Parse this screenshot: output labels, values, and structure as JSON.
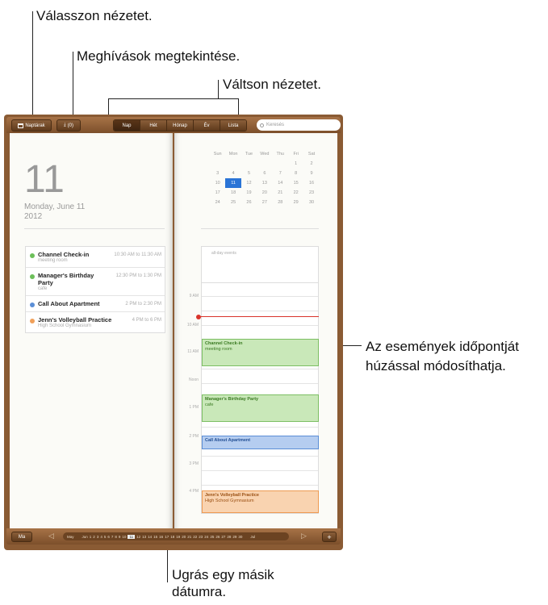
{
  "callouts": {
    "select_view": "Válasszon nézetet.",
    "view_invitations": "Meghívások megtekintése.",
    "switch_view": "Váltson nézetet.",
    "drag_events_1": "Az események időpontját",
    "drag_events_2": "húzással módosíthatja.",
    "jump_date_1": "Ugrás egy másik",
    "jump_date_2": "dátumra."
  },
  "toolbar": {
    "calendars_label": "Naptárak",
    "invitations_label": "(0)",
    "tabs": [
      "Nap",
      "Hét",
      "Hónap",
      "Év",
      "Lista"
    ],
    "active_tab": "Nap",
    "search_placeholder": "Keresés"
  },
  "left_page": {
    "day_number": "11",
    "date_line": "Monday, June 11",
    "year": "2012",
    "events": [
      {
        "title": "Channel Check-in",
        "location": "meeting room",
        "time": "10:30 AM to 11:30 AM",
        "color": "#6cbf5a"
      },
      {
        "title": "Manager's Birthday Party",
        "location": "cafe",
        "time": "12:30 PM to 1:30 PM",
        "color": "#6cbf5a"
      },
      {
        "title": "Call About Apartment",
        "location": "",
        "time": "2 PM to 2:30 PM",
        "color": "#5b8ed6"
      },
      {
        "title": "Jenn's Volleyball Practice",
        "location": "High School Gymnasium",
        "time": "4 PM to 6 PM",
        "color": "#f0a05a"
      }
    ]
  },
  "mini_calendar": {
    "weekdays": [
      "Sun",
      "Mon",
      "Tue",
      "Wed",
      "Thu",
      "Fri",
      "Sat"
    ],
    "weeks": [
      [
        "",
        "",
        "",
        "",
        "",
        "1",
        "2"
      ],
      [
        "3",
        "4",
        "5",
        "6",
        "7",
        "8",
        "9"
      ],
      [
        "10",
        "11",
        "12",
        "13",
        "14",
        "15",
        "16"
      ],
      [
        "17",
        "18",
        "19",
        "20",
        "21",
        "22",
        "23"
      ],
      [
        "24",
        "25",
        "26",
        "27",
        "28",
        "29",
        "30"
      ]
    ],
    "today": "11"
  },
  "day_view": {
    "all_day_label": "all-day events",
    "hour_labels": [
      "9 AM",
      "10 AM",
      "11 AM",
      "Noon",
      "1 PM",
      "2 PM",
      "3 PM",
      "4 PM"
    ],
    "blocks": [
      {
        "title": "Channel Check-in",
        "subtitle": "meeting room",
        "bg": "#c9e8b9",
        "border": "#7cbf63",
        "fg": "#3a7a22"
      },
      {
        "title": "Manager's Birthday Party",
        "subtitle": "cafe",
        "bg": "#c9e8b9",
        "border": "#7cbf63",
        "fg": "#3a7a22"
      },
      {
        "title": "Call About Apartment",
        "subtitle": "",
        "bg": "#b5cdf0",
        "border": "#5b8ed6",
        "fg": "#234f94"
      },
      {
        "title": "Jenn's Volleyball Practice",
        "subtitle": "High School Gymnasium",
        "bg": "#f9d3b0",
        "border": "#ee9a52",
        "fg": "#9a4f12"
      }
    ]
  },
  "bottombar": {
    "today_label": "Ma",
    "month_prev": "May",
    "month_cur": "Jun",
    "days": [
      "1",
      "2",
      "3",
      "4",
      "5",
      "6",
      "7",
      "8",
      "9",
      "10",
      "11",
      "12",
      "13",
      "14",
      "15",
      "16",
      "17",
      "18",
      "19",
      "20",
      "21",
      "22",
      "23",
      "24",
      "25",
      "26",
      "27",
      "28",
      "29",
      "30"
    ],
    "selected_day": "11",
    "month_next": "Jul",
    "add_label": "+"
  }
}
